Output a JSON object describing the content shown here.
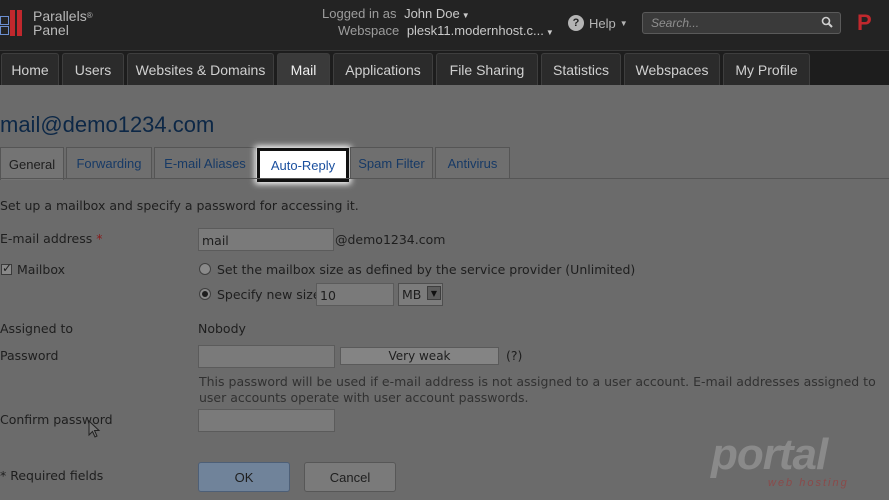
{
  "header": {
    "logo_line1": "Parallels",
    "logo_line2": "Panel",
    "logo_reg": "®",
    "logged_in_label": "Logged in as",
    "user_name": "John Doe",
    "webspace_label": "Webspace",
    "webspace_value": "plesk11.modernhost.c...",
    "help_label": "Help",
    "search_placeholder": "Search...",
    "brand_letter": "P"
  },
  "nav": {
    "tabs": [
      {
        "label": "Home"
      },
      {
        "label": "Users"
      },
      {
        "label": "Websites & Domains"
      },
      {
        "label": "Mail"
      },
      {
        "label": "Applications"
      },
      {
        "label": "File Sharing"
      },
      {
        "label": "Statistics"
      },
      {
        "label": "Webspaces"
      },
      {
        "label": "My Profile"
      }
    ]
  },
  "page": {
    "title": "mail@demo1234.com",
    "tabs": [
      {
        "label": "General"
      },
      {
        "label": "Forwarding"
      },
      {
        "label": "E-mail Aliases"
      },
      {
        "label": "Auto-Reply"
      },
      {
        "label": "Spam Filter"
      },
      {
        "label": "Antivirus"
      }
    ],
    "description": "Set up a mailbox and specify a password for accessing it."
  },
  "form": {
    "email_label": "E-mail address",
    "required_mark": "*",
    "email_value": "mail",
    "email_domain": "@demo1234.com",
    "mailbox_label": "Mailbox",
    "mailbox_checked": true,
    "size_option_default": "Set the mailbox size as defined by the service provider (Unlimited)",
    "size_option_custom": "Specify new size",
    "size_value": "10",
    "size_unit": "MB",
    "assigned_label": "Assigned to",
    "assigned_value": "Nobody",
    "password_label": "Password",
    "password_strength": "Very weak",
    "password_help_mark": "(?)",
    "password_hint": "This password will be used if e-mail address is not assigned to a user account. E-mail addresses assigned to user accounts operate with user account passwords.",
    "confirm_label": "Confirm password",
    "required_note": "* Required fields",
    "ok_label": "OK",
    "cancel_label": "Cancel"
  },
  "watermark": {
    "text": "portal",
    "subtext": "web hosting"
  },
  "colors": {
    "header_bg": "#232323",
    "brand_red": "#c0282d",
    "title_blue": "#0c2746",
    "link_blue": "#173a66"
  }
}
